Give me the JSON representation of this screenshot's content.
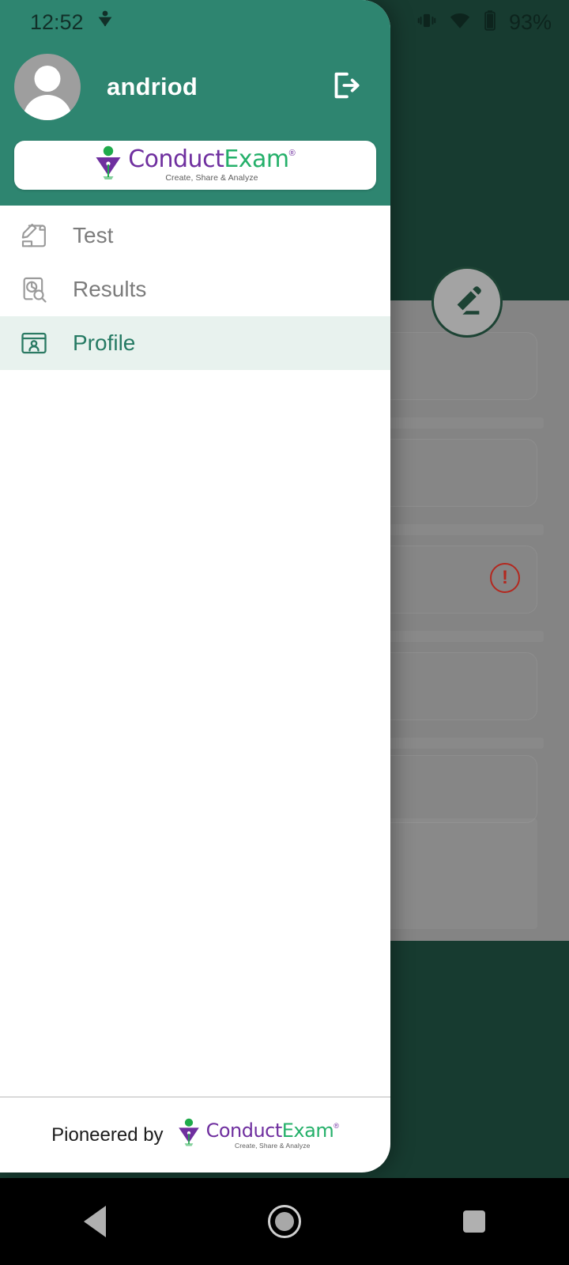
{
  "status_bar": {
    "clock": "12:52",
    "notification_icon": "conductexam-notification-icon",
    "vibrate_icon": "vibrate-icon",
    "wifi_icon": "wifi-icon",
    "battery_icon": "battery-icon",
    "battery_text": "93%"
  },
  "drawer": {
    "header": {
      "username": "andriod",
      "avatar_icon": "avatar-placeholder-icon",
      "logout_icon": "logout-icon"
    },
    "logo": {
      "word_1": "Conduct",
      "word_2": "Exam",
      "registered": "®",
      "tagline": "Create, Share & Analyze",
      "mark_icon": "conductexam-logo-mark"
    },
    "menu": [
      {
        "id": "test",
        "label": "Test",
        "icon": "test-scroll-pen-icon",
        "active": false
      },
      {
        "id": "results",
        "label": "Results",
        "icon": "results-chart-search-icon",
        "active": false
      },
      {
        "id": "profile",
        "label": "Profile",
        "icon": "profile-card-icon",
        "active": true
      }
    ],
    "footer": {
      "pioneered_text": "Pioneered by"
    }
  },
  "background_app": {
    "fab_icon": "edit-pencil-icon",
    "error_icon": "error-exclamation-icon",
    "error_mark": "!"
  },
  "nav_bar": {
    "back_icon": "nav-back-icon",
    "home_icon": "nav-home-icon",
    "recents_icon": "nav-recents-icon"
  },
  "colors": {
    "drawer_header_green": "#2e8570",
    "app_dark_green": "#173b30",
    "active_item_bg": "#e8f2ee",
    "active_item_text": "#257a63",
    "logo_purple": "#6f2f9f",
    "logo_green": "#25b06a",
    "error_red": "#b3281f",
    "scrim_grey": "#848484"
  }
}
